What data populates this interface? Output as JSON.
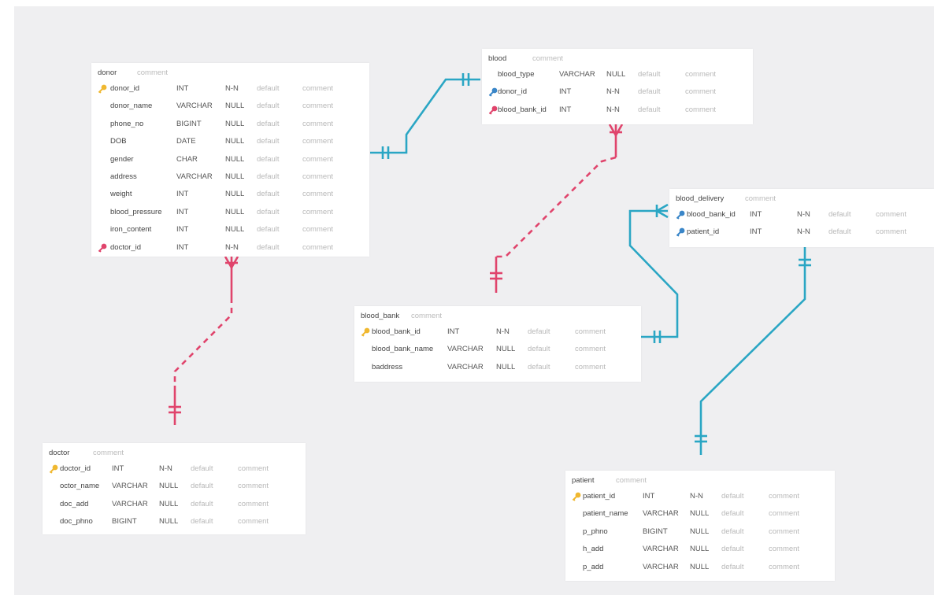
{
  "colors": {
    "background": "#efeff1",
    "table_bg": "#ffffff",
    "link_teal": "#2aa6c4",
    "link_pink": "#e0446c",
    "pk_key": "#f0b830",
    "fk_key_pink": "#e0446c",
    "fk_key_blue": "#3a86c8"
  },
  "tables": {
    "donor": {
      "name": "donor",
      "comment": "comment",
      "rows": [
        {
          "key": "pk-key-icon",
          "name": "donor_id",
          "type": "INT",
          "null": "N-N",
          "default": "default",
          "comment": "comment"
        },
        {
          "key": "",
          "name": "donor_name",
          "type": "VARCHAR",
          "null": "NULL",
          "default": "default",
          "comment": "comment"
        },
        {
          "key": "",
          "name": "phone_no",
          "type": "BIGINT",
          "null": "NULL",
          "default": "default",
          "comment": "comment"
        },
        {
          "key": "",
          "name": "DOB",
          "type": "DATE",
          "null": "NULL",
          "default": "default",
          "comment": "comment"
        },
        {
          "key": "",
          "name": "gender",
          "type": "CHAR",
          "null": "NULL",
          "default": "default",
          "comment": "comment"
        },
        {
          "key": "",
          "name": "address",
          "type": "VARCHAR",
          "null": "NULL",
          "default": "default",
          "comment": "comment"
        },
        {
          "key": "",
          "name": "weight",
          "type": "INT",
          "null": "NULL",
          "default": "default",
          "comment": "comment"
        },
        {
          "key": "",
          "name": "blood_pressure",
          "type": "INT",
          "null": "NULL",
          "default": "default",
          "comment": "comment"
        },
        {
          "key": "",
          "name": "iron_content",
          "type": "INT",
          "null": "NULL",
          "default": "default",
          "comment": "comment"
        },
        {
          "key": "fk-key-pink-icon",
          "name": "doctor_id",
          "type": "INT",
          "null": "N-N",
          "default": "default",
          "comment": "comment"
        }
      ]
    },
    "blood": {
      "name": "blood",
      "comment": "comment",
      "rows": [
        {
          "key": "",
          "name": "blood_type",
          "type": "VARCHAR",
          "null": "NULL",
          "default": "default",
          "comment": "comment"
        },
        {
          "key": "fk-key-blue-icon",
          "name": "donor_id",
          "type": "INT",
          "null": "N-N",
          "default": "default",
          "comment": "comment"
        },
        {
          "key": "fk-key-pink-icon",
          "name": "blood_bank_id",
          "type": "INT",
          "null": "N-N",
          "default": "default",
          "comment": "comment"
        }
      ]
    },
    "blood_delivery": {
      "name": "blood_delivery",
      "comment": "comment",
      "rows": [
        {
          "key": "fk-key-blue-icon",
          "name": "blood_bank_id",
          "type": "INT",
          "null": "N-N",
          "default": "default",
          "comment": "comment"
        },
        {
          "key": "fk-key-blue-icon",
          "name": "patient_id",
          "type": "INT",
          "null": "N-N",
          "default": "default",
          "comment": "comment"
        }
      ]
    },
    "blood_bank": {
      "name": "blood_bank",
      "comment": "comment",
      "rows": [
        {
          "key": "pk-key-icon",
          "name": "blood_bank_id",
          "type": "INT",
          "null": "N-N",
          "default": "default",
          "comment": "comment"
        },
        {
          "key": "",
          "name": "blood_bank_name",
          "type": "VARCHAR",
          "null": "NULL",
          "default": "default",
          "comment": "comment"
        },
        {
          "key": "",
          "name": "baddress",
          "type": "VARCHAR",
          "null": "NULL",
          "default": "default",
          "comment": "comment"
        }
      ]
    },
    "doctor": {
      "name": "doctor",
      "comment": "comment",
      "rows": [
        {
          "key": "pk-key-icon",
          "name": "doctor_id",
          "type": "INT",
          "null": "N-N",
          "default": "default",
          "comment": "comment"
        },
        {
          "key": "",
          "name": "octor_name",
          "type": "VARCHAR",
          "null": "NULL",
          "default": "default",
          "comment": "comment"
        },
        {
          "key": "",
          "name": "doc_add",
          "type": "VARCHAR",
          "null": "NULL",
          "default": "default",
          "comment": "comment"
        },
        {
          "key": "",
          "name": "doc_phno",
          "type": "BIGINT",
          "null": "NULL",
          "default": "default",
          "comment": "comment"
        }
      ]
    },
    "patient": {
      "name": "patient",
      "comment": "comment",
      "rows": [
        {
          "key": "pk-key-icon",
          "name": "patient_id",
          "type": "INT",
          "null": "N-N",
          "default": "default",
          "comment": "comment"
        },
        {
          "key": "",
          "name": "patient_name",
          "type": "VARCHAR",
          "null": "NULL",
          "default": "default",
          "comment": "comment"
        },
        {
          "key": "",
          "name": "p_phno",
          "type": "BIGINT",
          "null": "NULL",
          "default": "default",
          "comment": "comment"
        },
        {
          "key": "",
          "name": "h_add",
          "type": "VARCHAR",
          "null": "NULL",
          "default": "default",
          "comment": "comment"
        },
        {
          "key": "",
          "name": "p_add",
          "type": "VARCHAR",
          "null": "NULL",
          "default": "default",
          "comment": "comment"
        }
      ]
    }
  }
}
